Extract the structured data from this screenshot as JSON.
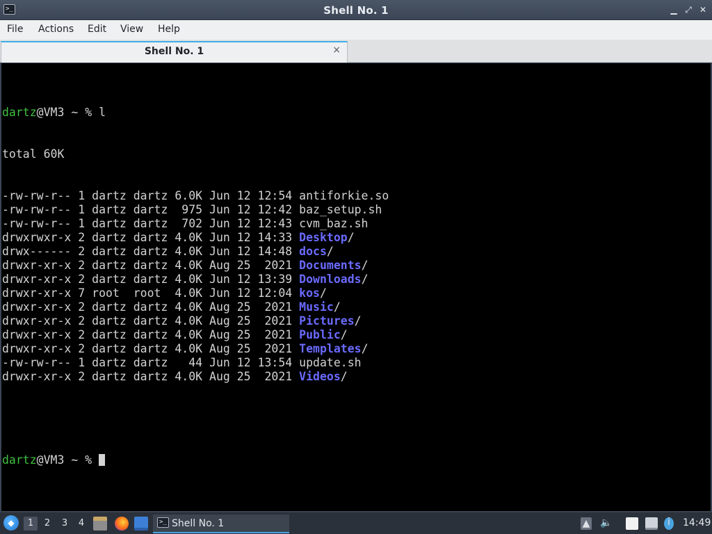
{
  "window": {
    "title": "Shell No. 1",
    "app_icon": ">_",
    "controls": {
      "minimize": "▁",
      "maximize": "⤢",
      "close": "✕"
    }
  },
  "menu": [
    "File",
    "Actions",
    "Edit",
    "View",
    "Help"
  ],
  "tab": {
    "label": "Shell No. 1",
    "close": "×"
  },
  "terminal": {
    "prompt_user": "dartz",
    "prompt_rest": "@VM3 ~ % ",
    "command": "l",
    "total": "total 60K",
    "entries": [
      {
        "meta": "-rw-rw-r-- 1 dartz dartz 6.0K Jun 12 12:54 ",
        "name": "antiforkie.so",
        "suffix": "",
        "is_dir": false
      },
      {
        "meta": "-rw-rw-r-- 1 dartz dartz  975 Jun 12 12:42 ",
        "name": "baz_setup.sh",
        "suffix": "",
        "is_dir": false
      },
      {
        "meta": "-rw-rw-r-- 1 dartz dartz  702 Jun 12 12:43 ",
        "name": "cvm_baz.sh",
        "suffix": "",
        "is_dir": false
      },
      {
        "meta": "drwxrwxr-x 2 dartz dartz 4.0K Jun 12 14:33 ",
        "name": "Desktop",
        "suffix": "/",
        "is_dir": true
      },
      {
        "meta": "drwx------ 2 dartz dartz 4.0K Jun 12 14:48 ",
        "name": "docs",
        "suffix": "/",
        "is_dir": true
      },
      {
        "meta": "drwxr-xr-x 2 dartz dartz 4.0K Aug 25  2021 ",
        "name": "Documents",
        "suffix": "/",
        "is_dir": true
      },
      {
        "meta": "drwxr-xr-x 2 dartz dartz 4.0K Jun 12 13:39 ",
        "name": "Downloads",
        "suffix": "/",
        "is_dir": true
      },
      {
        "meta": "drwxr-xr-x 7 root  root  4.0K Jun 12 12:04 ",
        "name": "kos",
        "suffix": "/",
        "is_dir": true
      },
      {
        "meta": "drwxr-xr-x 2 dartz dartz 4.0K Aug 25  2021 ",
        "name": "Music",
        "suffix": "/",
        "is_dir": true
      },
      {
        "meta": "drwxr-xr-x 2 dartz dartz 4.0K Aug 25  2021 ",
        "name": "Pictures",
        "suffix": "/",
        "is_dir": true
      },
      {
        "meta": "drwxr-xr-x 2 dartz dartz 4.0K Aug 25  2021 ",
        "name": "Public",
        "suffix": "/",
        "is_dir": true
      },
      {
        "meta": "drwxr-xr-x 2 dartz dartz 4.0K Aug 25  2021 ",
        "name": "Templates",
        "suffix": "/",
        "is_dir": true
      },
      {
        "meta": "-rw-rw-r-- 1 dartz dartz   44 Jun 12 13:54 ",
        "name": "update.sh",
        "suffix": "",
        "is_dir": false
      },
      {
        "meta": "drwxr-xr-x 2 dartz dartz 4.0K Aug 25  2021 ",
        "name": "Videos",
        "suffix": "/",
        "is_dir": true
      }
    ]
  },
  "taskbar": {
    "workspaces": [
      "1",
      "2",
      "3",
      "4"
    ],
    "active_workspace": "1",
    "task_label": "Shell No. 1",
    "clock": "14:49",
    "icons": {
      "launcher": "app-menu-icon",
      "files": "file-manager-icon",
      "browser": "firefox-icon",
      "desktop": "show-desktop-icon",
      "tray_up": "tray-expand-icon",
      "volume": "volume-icon",
      "clipboard": "clipboard-icon",
      "network": "network-icon",
      "info": "notification-icon"
    }
  },
  "colors": {
    "prompt_user": "#3fbf3f",
    "directory": "#6a6aff",
    "terminal_bg": "#000000",
    "terminal_fg": "#d3d3d3",
    "accent": "#3daee9"
  }
}
